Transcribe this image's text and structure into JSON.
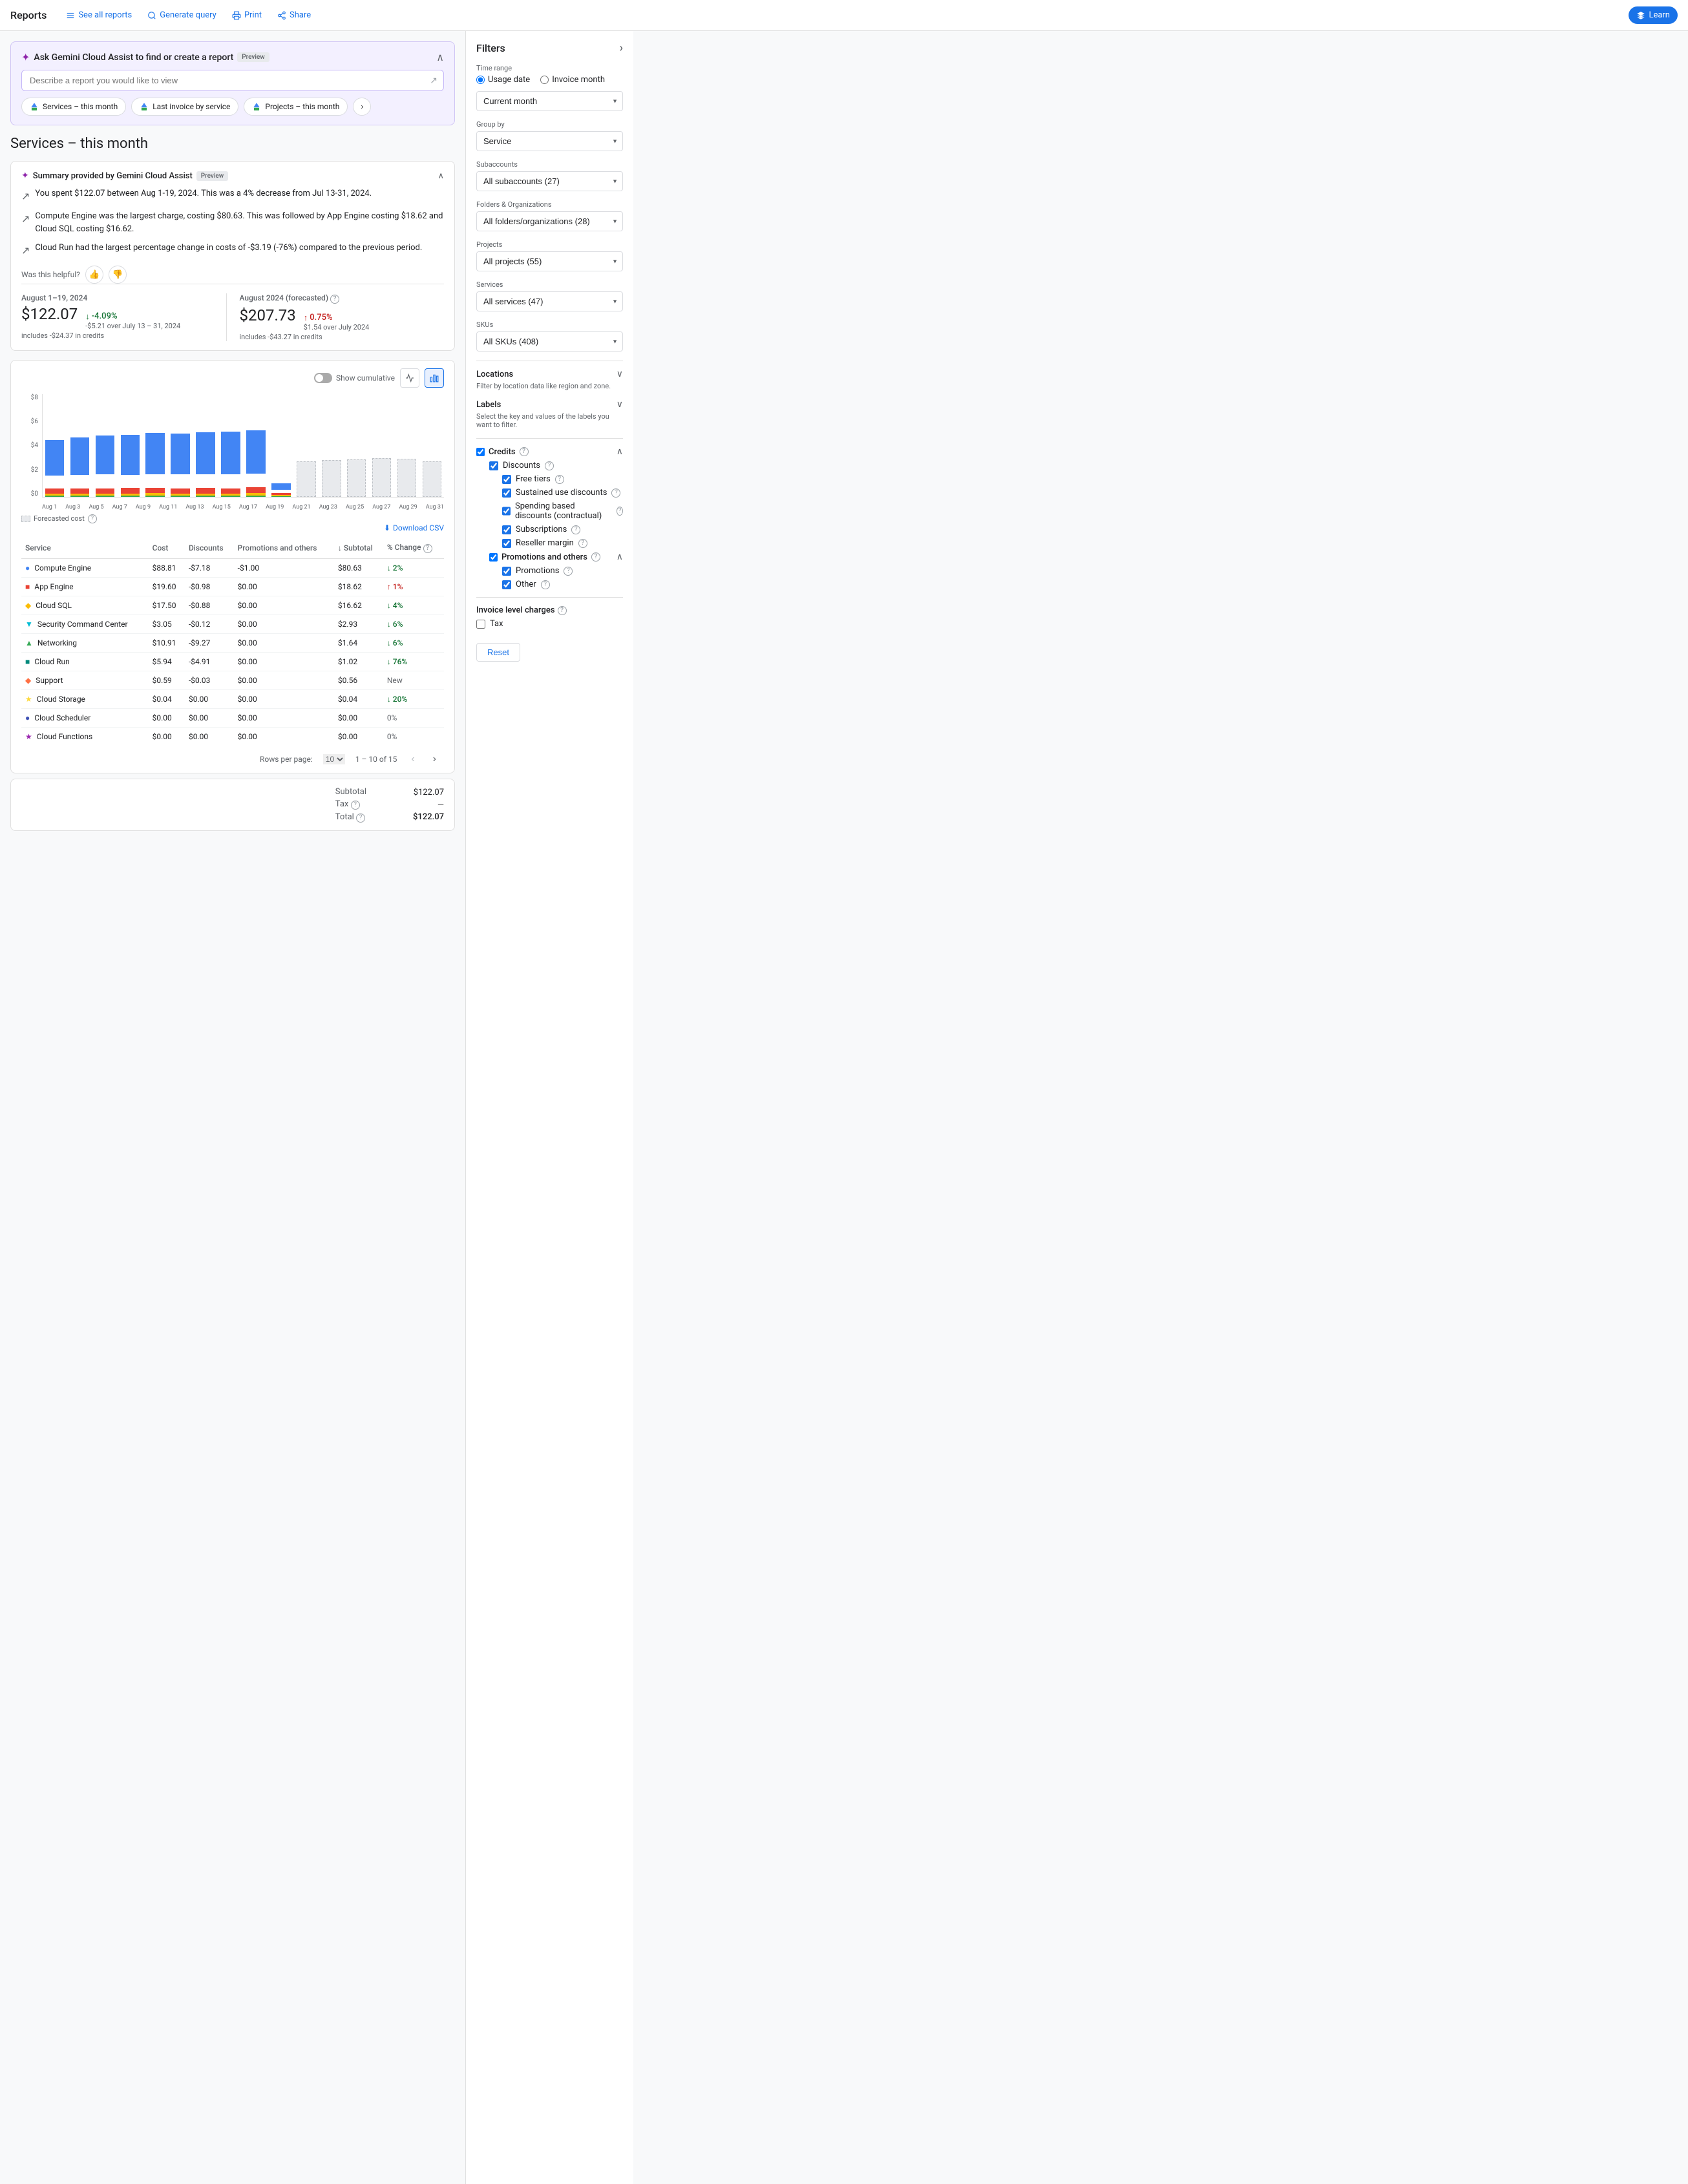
{
  "nav": {
    "title": "Reports",
    "links": [
      {
        "label": "See all reports",
        "icon": "list-icon"
      },
      {
        "label": "Generate query",
        "icon": "search-icon"
      },
      {
        "label": "Print",
        "icon": "print-icon"
      },
      {
        "label": "Share",
        "icon": "share-icon"
      }
    ],
    "learn_label": "Learn",
    "learn_icon": "learn-icon"
  },
  "gemini": {
    "title": "Ask Gemini Cloud Assist to find or create a report",
    "preview_badge": "Preview",
    "input_placeholder": "Describe a report you would like to view",
    "quick_tabs": [
      {
        "label": "Services – this month",
        "icon": "gcp-icon"
      },
      {
        "label": "Last invoice by service",
        "icon": "gcp-icon"
      },
      {
        "label": "Projects – this month",
        "icon": "gcp-icon"
      }
    ]
  },
  "page_title": "Services – this month",
  "summary": {
    "title": "Summary provided by Gemini Cloud Assist",
    "preview_badge": "Preview",
    "bullets": [
      "You spent $122.07 between Aug 1-19, 2024. This was a 4% decrease from Jul 13-31, 2024.",
      "Compute Engine was the largest charge, costing $80.63. This was followed by App Engine costing $18.62 and Cloud SQL costing $16.62.",
      "Cloud Run had the largest percentage change in costs of -$3.19 (-76%) compared to the previous period."
    ],
    "feedback_label": "Was this helpful?"
  },
  "metrics": {
    "current": {
      "date": "August 1–19, 2024",
      "value": "$122.07",
      "subtitle": "includes -$24.37 in credits",
      "change": "-4.09%",
      "change_direction": "down",
      "change_label": "-$5.21 over July 13 – 31, 2024"
    },
    "forecasted": {
      "date": "August 2024 (forecasted)",
      "value": "$207.73",
      "subtitle": "includes -$43.27 in credits",
      "change": "0.75%",
      "change_direction": "up",
      "change_label": "$1.54 over July 2024"
    }
  },
  "chart": {
    "show_cumulative_label": "Show cumulative",
    "y_labels": [
      "$8",
      "$6",
      "$4",
      "$2",
      "$0"
    ],
    "x_labels": [
      "Aug 1",
      "Aug 3",
      "Aug 5",
      "Aug 7",
      "Aug 9",
      "Aug 11",
      "Aug 13",
      "Aug 15",
      "Aug 17",
      "Aug 19",
      "Aug 21",
      "Aug 23",
      "Aug 25",
      "Aug 27",
      "Aug 29",
      "Aug 31"
    ],
    "forecasted_label": "Forecasted cost"
  },
  "download_label": "Download CSV",
  "table": {
    "headers": [
      "Service",
      "Cost",
      "Discounts",
      "Promotions and others",
      "Subtotal",
      "% Change"
    ],
    "rows": [
      {
        "service": "Compute Engine",
        "color": "blue",
        "shape": "circle",
        "cost": "$88.81",
        "discounts": "-$7.18",
        "promotions": "-$1.00",
        "subtotal": "$80.63",
        "change": "2%",
        "change_dir": "down"
      },
      {
        "service": "App Engine",
        "color": "red",
        "shape": "square",
        "cost": "$19.60",
        "discounts": "-$0.98",
        "promotions": "$0.00",
        "subtotal": "$18.62",
        "change": "1%",
        "change_dir": "up"
      },
      {
        "service": "Cloud SQL",
        "color": "yellow",
        "shape": "diamond",
        "cost": "$17.50",
        "discounts": "-$0.88",
        "promotions": "$0.00",
        "subtotal": "$16.62",
        "change": "4%",
        "change_dir": "down"
      },
      {
        "service": "Security Command Center",
        "color": "teal",
        "shape": "triangle",
        "cost": "$3.05",
        "discounts": "-$0.12",
        "promotions": "$0.00",
        "subtotal": "$2.93",
        "change": "6%",
        "change_dir": "down"
      },
      {
        "service": "Networking",
        "color": "green",
        "shape": "triangle-up",
        "cost": "$10.91",
        "discounts": "-$9.27",
        "promotions": "$0.00",
        "subtotal": "$1.64",
        "change": "6%",
        "change_dir": "down"
      },
      {
        "service": "Cloud Run",
        "color": "teal2",
        "shape": "square2",
        "cost": "$5.94",
        "discounts": "-$4.91",
        "promotions": "$0.00",
        "subtotal": "$1.02",
        "change": "76%",
        "change_dir": "down"
      },
      {
        "service": "Support",
        "color": "orange",
        "shape": "diamond2",
        "cost": "$0.59",
        "discounts": "-$0.03",
        "promotions": "$0.00",
        "subtotal": "$0.56",
        "change": "New",
        "change_dir": "none"
      },
      {
        "service": "Cloud Storage",
        "color": "gold",
        "shape": "star",
        "cost": "$0.04",
        "discounts": "$0.00",
        "promotions": "$0.00",
        "subtotal": "$0.04",
        "change": "20%",
        "change_dir": "down"
      },
      {
        "service": "Cloud Scheduler",
        "color": "navy",
        "shape": "circle2",
        "cost": "$0.00",
        "discounts": "$0.00",
        "promotions": "$0.00",
        "subtotal": "$0.00",
        "change": "0%",
        "change_dir": "none"
      },
      {
        "service": "Cloud Functions",
        "color": "purple",
        "shape": "star2",
        "cost": "$0.00",
        "discounts": "$0.00",
        "promotions": "$0.00",
        "subtotal": "$0.00",
        "change": "0%",
        "change_dir": "none"
      }
    ],
    "pagination": {
      "rows_per_page_label": "Rows per page:",
      "rows_per_page": "10",
      "range": "1 – 10 of 15"
    }
  },
  "totals": {
    "subtotal_label": "Subtotal",
    "subtotal_value": "$122.07",
    "tax_label": "Tax",
    "tax_value": "—",
    "total_label": "Total",
    "total_value": "$122.07"
  },
  "filters": {
    "title": "Filters",
    "time_range_label": "Time range",
    "usage_date_label": "Usage date",
    "invoice_month_label": "Invoice month",
    "current_month_label": "Current month",
    "group_by_label": "Group by",
    "group_by_value": "Service",
    "subaccounts_label": "Subaccounts",
    "subaccounts_value": "All subaccounts (27)",
    "folders_label": "Folders & Organizations",
    "folders_value": "All folders/organizations (28)",
    "projects_label": "Projects",
    "projects_value": "All projects (55)",
    "services_label": "Services",
    "services_value": "All services (47)",
    "skus_label": "SKUs",
    "skus_value": "All SKUs (408)",
    "locations_label": "Locations",
    "locations_desc": "Filter by location data like region and zone.",
    "labels_label": "Labels",
    "labels_desc": "Select the key and values of the labels you want to filter.",
    "credits_label": "Credits",
    "discounts_label": "Discounts",
    "free_tiers_label": "Free tiers",
    "sustained_label": "Sustained use discounts",
    "spending_label": "Spending based discounts (contractual)",
    "subscriptions_label": "Subscriptions",
    "reseller_label": "Reseller margin",
    "promotions_others_label": "Promotions and others",
    "promotions_label": "Promotions",
    "other_label": "Other",
    "invoice_charges_label": "Invoice level charges",
    "tax_label": "Tax",
    "reset_label": "Reset"
  }
}
